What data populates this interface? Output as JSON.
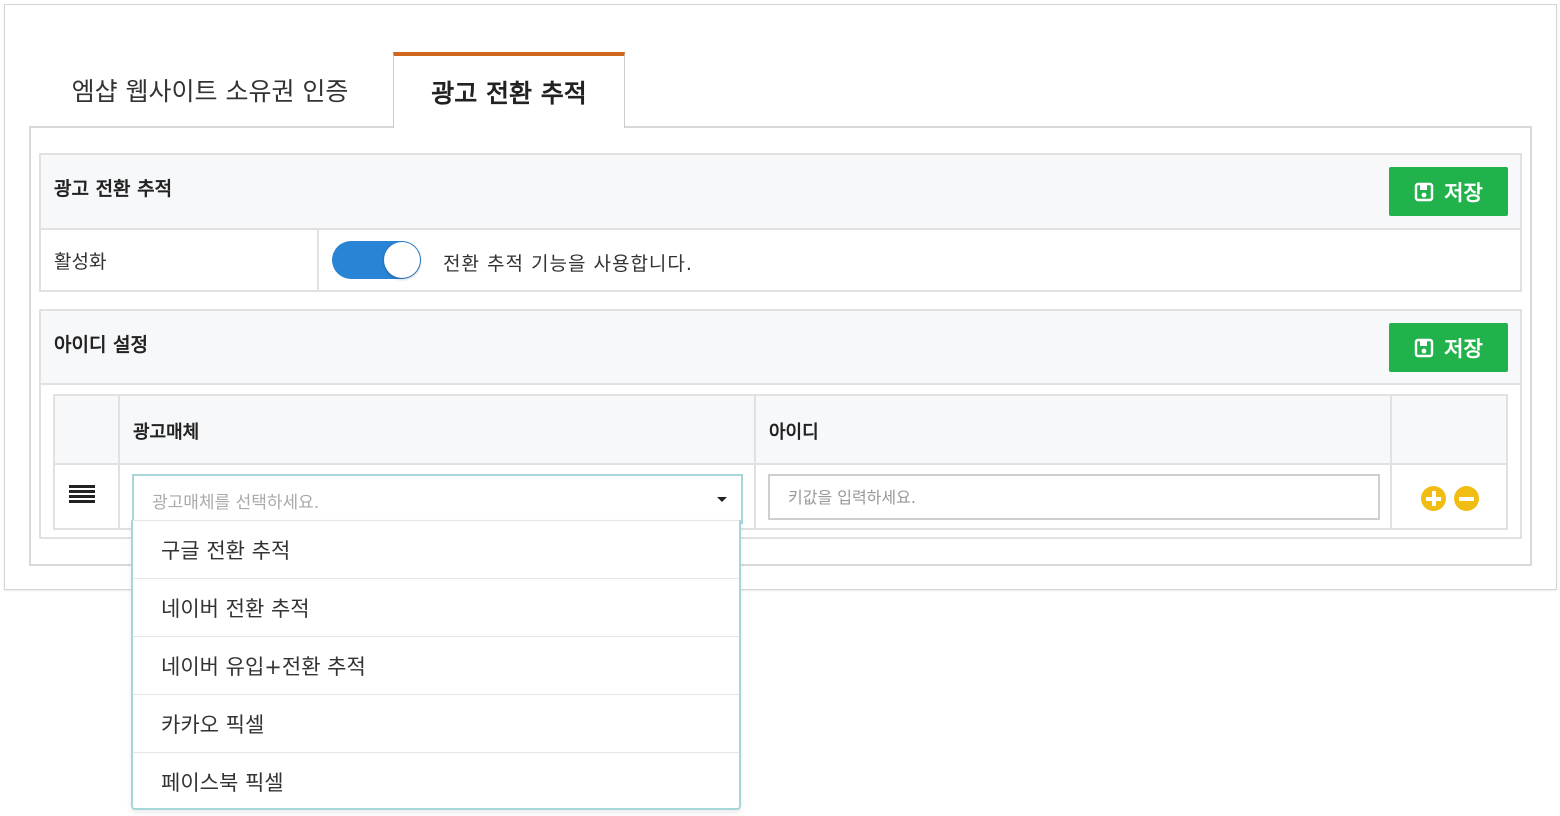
{
  "tabs": [
    {
      "label": "엠샵 웹사이트 소유권 인증",
      "active": false
    },
    {
      "label": "광고 전환 추적",
      "active": true
    }
  ],
  "tracking_section": {
    "title": "광고 전환 추적",
    "save_label": "저장",
    "activation": {
      "label": "활성화",
      "enabled": true,
      "description": "전환 추적 기능을 사용합니다."
    }
  },
  "id_section": {
    "title": "아이디 설정",
    "save_label": "저장",
    "table": {
      "columns": [
        "광고매체",
        "아이디"
      ],
      "row": {
        "media_placeholder": "광고매체를 선택하세요.",
        "id_placeholder": "키값을 입력하세요."
      }
    },
    "dropdown_options": [
      "구글 전환 추적",
      "네이버 전환 추적",
      "네이버 유입+전환 추적",
      "카카오 픽셀",
      "페이스북 픽셀"
    ]
  },
  "colors": {
    "accent_tab": "#d0671e",
    "save_button": "#21b24b",
    "toggle_on": "#2a84d6",
    "row_action": "#f1bd13"
  }
}
